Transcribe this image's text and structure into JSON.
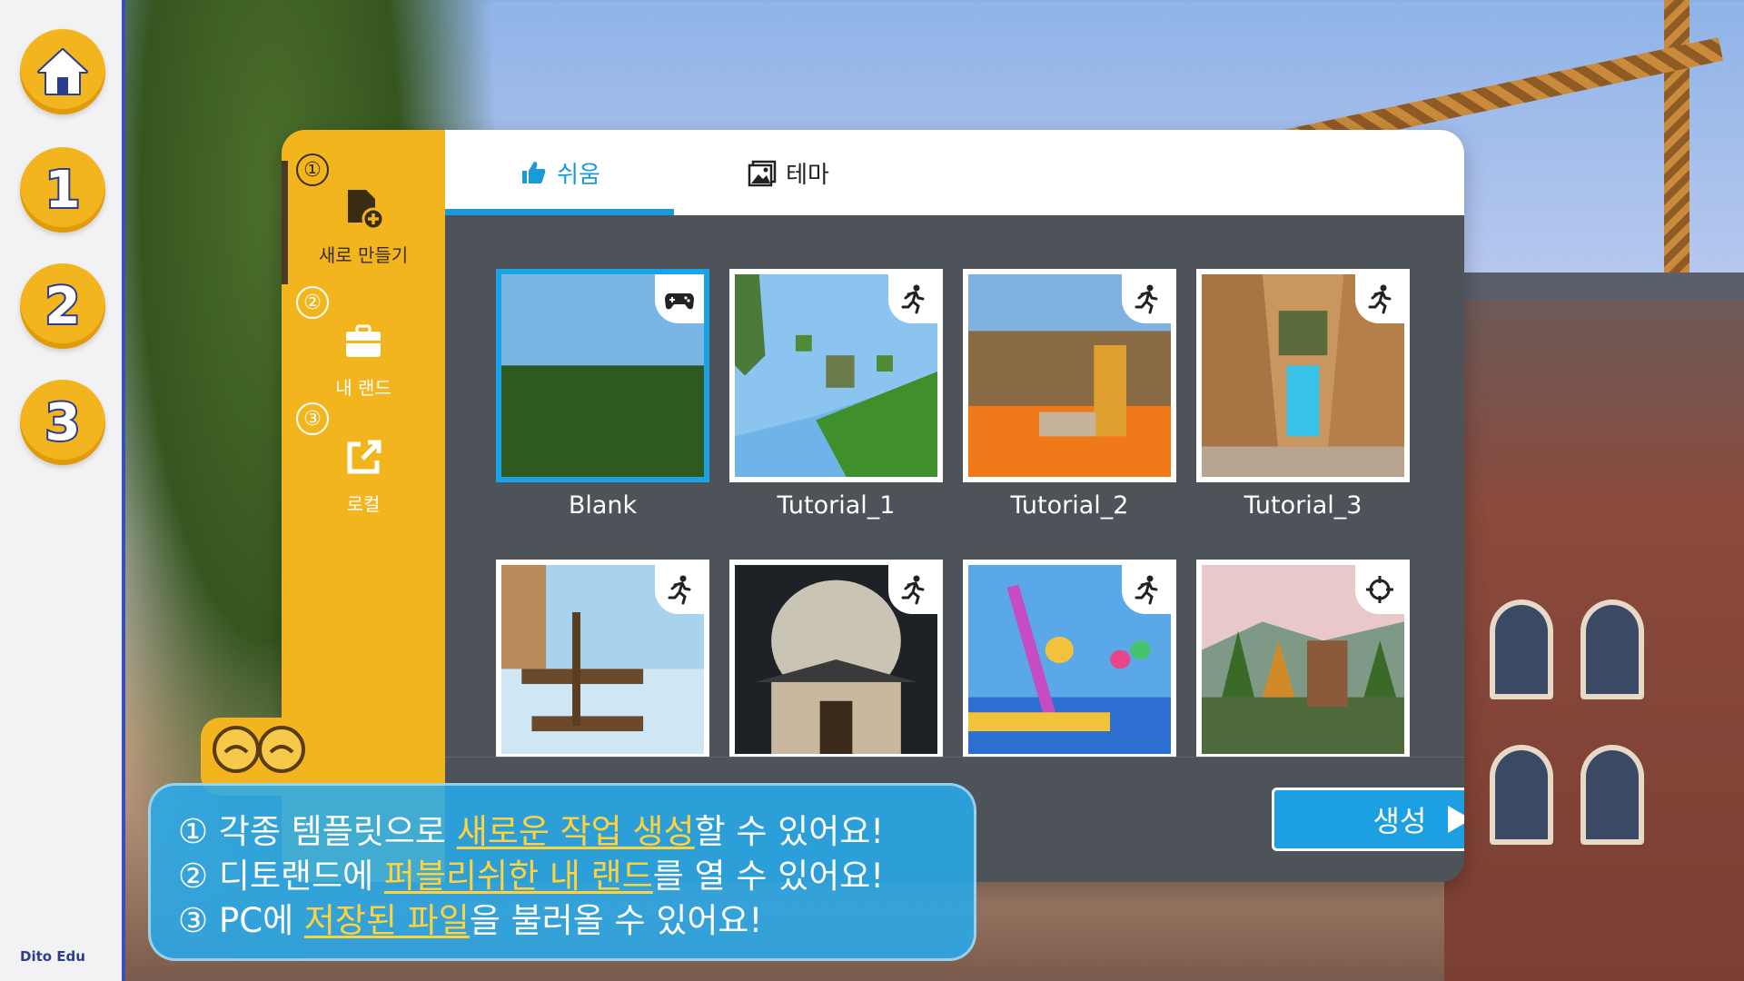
{
  "rail": {
    "items": [
      "",
      "1",
      "2",
      "3"
    ],
    "logo": "Dito Edu"
  },
  "sidebar": {
    "items": [
      {
        "num": "①",
        "label": "새로 만들기"
      },
      {
        "num": "②",
        "label": "내 랜드"
      },
      {
        "num": "③",
        "label": "로컬"
      }
    ]
  },
  "tabs": [
    {
      "label": "쉬움"
    },
    {
      "label": "테마"
    }
  ],
  "templates": [
    {
      "label": "Blank",
      "badge": "gamepad-icon"
    },
    {
      "label": "Tutorial_1",
      "badge": "runner-icon"
    },
    {
      "label": "Tutorial_2",
      "badge": "runner-icon"
    },
    {
      "label": "Tutorial_3",
      "badge": "runner-icon"
    },
    {
      "label": "",
      "badge": "runner-icon"
    },
    {
      "label": "",
      "badge": "runner-icon"
    },
    {
      "label": "",
      "badge": "runner-icon"
    },
    {
      "label": "",
      "badge": "crosshair-icon"
    }
  ],
  "create_button": {
    "label": "생성"
  },
  "help": {
    "line1": {
      "prefix": "① 각종 템플릿으로 ",
      "highlight": "새로운 작업 생성",
      "suffix": "할 수 있어요!"
    },
    "line2": {
      "prefix": "② 디토랜드에 ",
      "highlight": "퍼블리쉬한 내 랜드",
      "suffix": "를 열 수 있어요!"
    },
    "line3": {
      "prefix": "③ PC에 ",
      "highlight": "저장된 파일",
      "suffix": "을 불러올 수 있어요!"
    }
  },
  "colors": {
    "accent": "#1a9ad9",
    "sidebar": "#f3b51d",
    "panel": "#4d5359",
    "highlight": "#ffd23d"
  }
}
